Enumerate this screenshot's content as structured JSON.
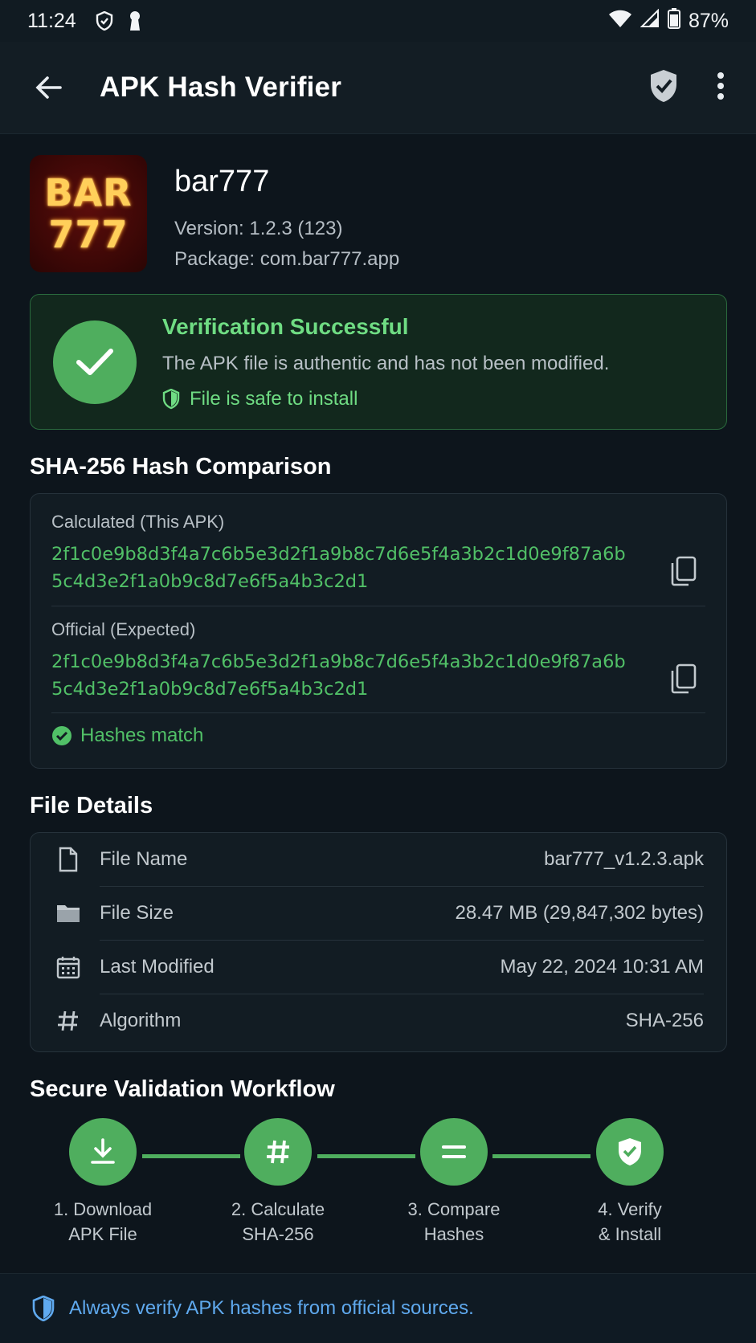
{
  "status_bar": {
    "time": "11:24",
    "battery": "87%"
  },
  "app_bar": {
    "title": "APK Hash Verifier"
  },
  "app": {
    "logo_line1": "BAR",
    "logo_line2": "777",
    "name": "bar777",
    "version": "Version: 1.2.3 (123)",
    "package": "Package: com.bar777.app"
  },
  "verification": {
    "title": "Verification Successful",
    "description": "The APK file is authentic and has not been modified.",
    "safe_label": "File is safe to install"
  },
  "hash_section": {
    "title": "SHA-256 Hash Comparison",
    "calculated_label": "Calculated (This APK)",
    "calculated_value": "2f1c0e9b8d3f4a7c6b5e3d2f1a9b8c7d6e5f4a3b2c1d0e9f87a6b5c4d3e2f1a0b9c8d7e6f5a4b3c2d1",
    "official_label": "Official (Expected)",
    "official_value": "2f1c0e9b8d3f4a7c6b5e3d2f1a9b8c7d6e5f4a3b2c1d0e9f87a6b5c4d3e2f1a0b9c8d7e6f5a4b3c2d1",
    "match_label": "Hashes match"
  },
  "details_section": {
    "title": "File Details",
    "rows": [
      {
        "label": "File Name",
        "value": "bar777_v1.2.3.apk",
        "icon": "file-icon"
      },
      {
        "label": "File Size",
        "value": "28.47 MB (29,847,302 bytes)",
        "icon": "folder-icon"
      },
      {
        "label": "Last Modified",
        "value": "May 22, 2024 10:31 AM",
        "icon": "calendar-icon"
      },
      {
        "label": "Algorithm",
        "value": "SHA-256",
        "icon": "hash-icon"
      }
    ]
  },
  "workflow": {
    "title": "Secure Validation Workflow",
    "steps": [
      {
        "label": "1. Download\nAPK File",
        "icon": "download-icon"
      },
      {
        "label": "2. Calculate\nSHA-256",
        "icon": "hash-icon"
      },
      {
        "label": "3. Compare\nHashes",
        "icon": "equals-icon"
      },
      {
        "label": "4. Verify\n& Install",
        "icon": "shield-check-icon"
      }
    ]
  },
  "footer": {
    "text": "Always verify APK hashes from official sources."
  },
  "colors": {
    "accent_green": "#4fae5e",
    "success_text": "#6fdc83",
    "hash_text": "#51c067",
    "info_blue": "#5fa9ee",
    "background": "#0d151c"
  }
}
